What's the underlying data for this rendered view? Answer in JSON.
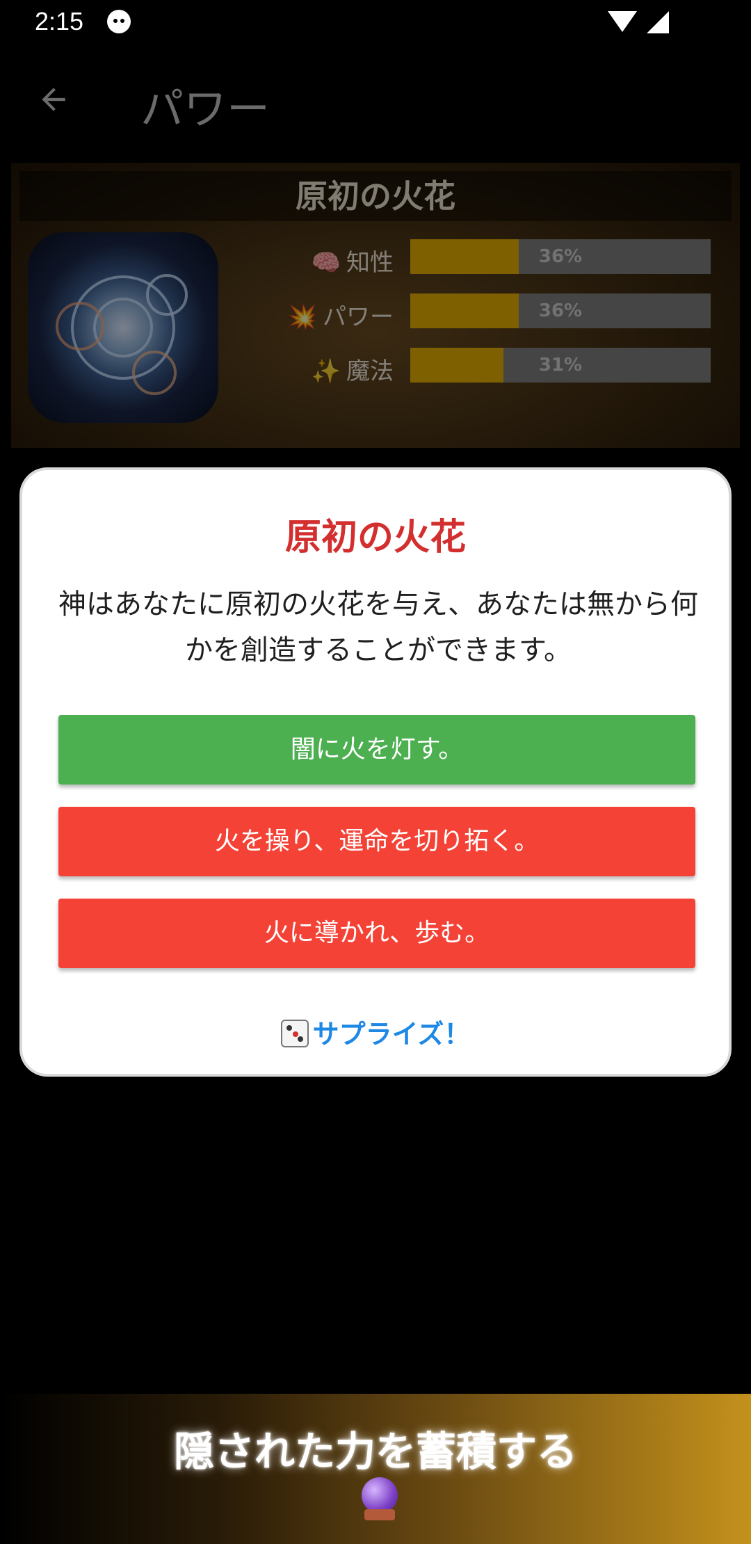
{
  "status_bar": {
    "time": "2:15",
    "icons": [
      "cat-icon",
      "wifi-icon",
      "signal-icon"
    ]
  },
  "app_bar": {
    "title": "パワー",
    "back_icon": "arrow-left-icon"
  },
  "profile_card": {
    "title": "原初の火花",
    "avatar_icon": "cosmic-orb-image",
    "stats": [
      {
        "emoji": "🧠",
        "label": "知性",
        "value": 0.36,
        "percent_text": "36%"
      },
      {
        "emoji": "💥",
        "label": "パワー",
        "value": 0.36,
        "percent_text": "36%"
      },
      {
        "emoji": "✨",
        "label": "魔法",
        "value": 0.31,
        "percent_text": "31%"
      }
    ],
    "colors": {
      "bar_fill": "#e8b000",
      "bar_track": "#7f7f7f"
    }
  },
  "dialog": {
    "title": "原初の火花",
    "body": "神はあなたに原初の火花を与え、あなたは無から何かを創造することができます。",
    "options": [
      {
        "label": "闇に火を灯す。",
        "color": "#4caf50"
      },
      {
        "label": "火を操り、運命を切り拓く。",
        "color": "#f44336"
      },
      {
        "label": "火に導かれ、歩む。",
        "color": "#f44336"
      }
    ],
    "surprise_label": "サプライズ！",
    "surprise_icon": "dice-icon",
    "colors": {
      "title": "#d32f2f",
      "link": "#1e88e5"
    }
  },
  "bottom_banner": {
    "text": "隠された力を蓄積する",
    "icon": "crystal-ball-icon"
  }
}
